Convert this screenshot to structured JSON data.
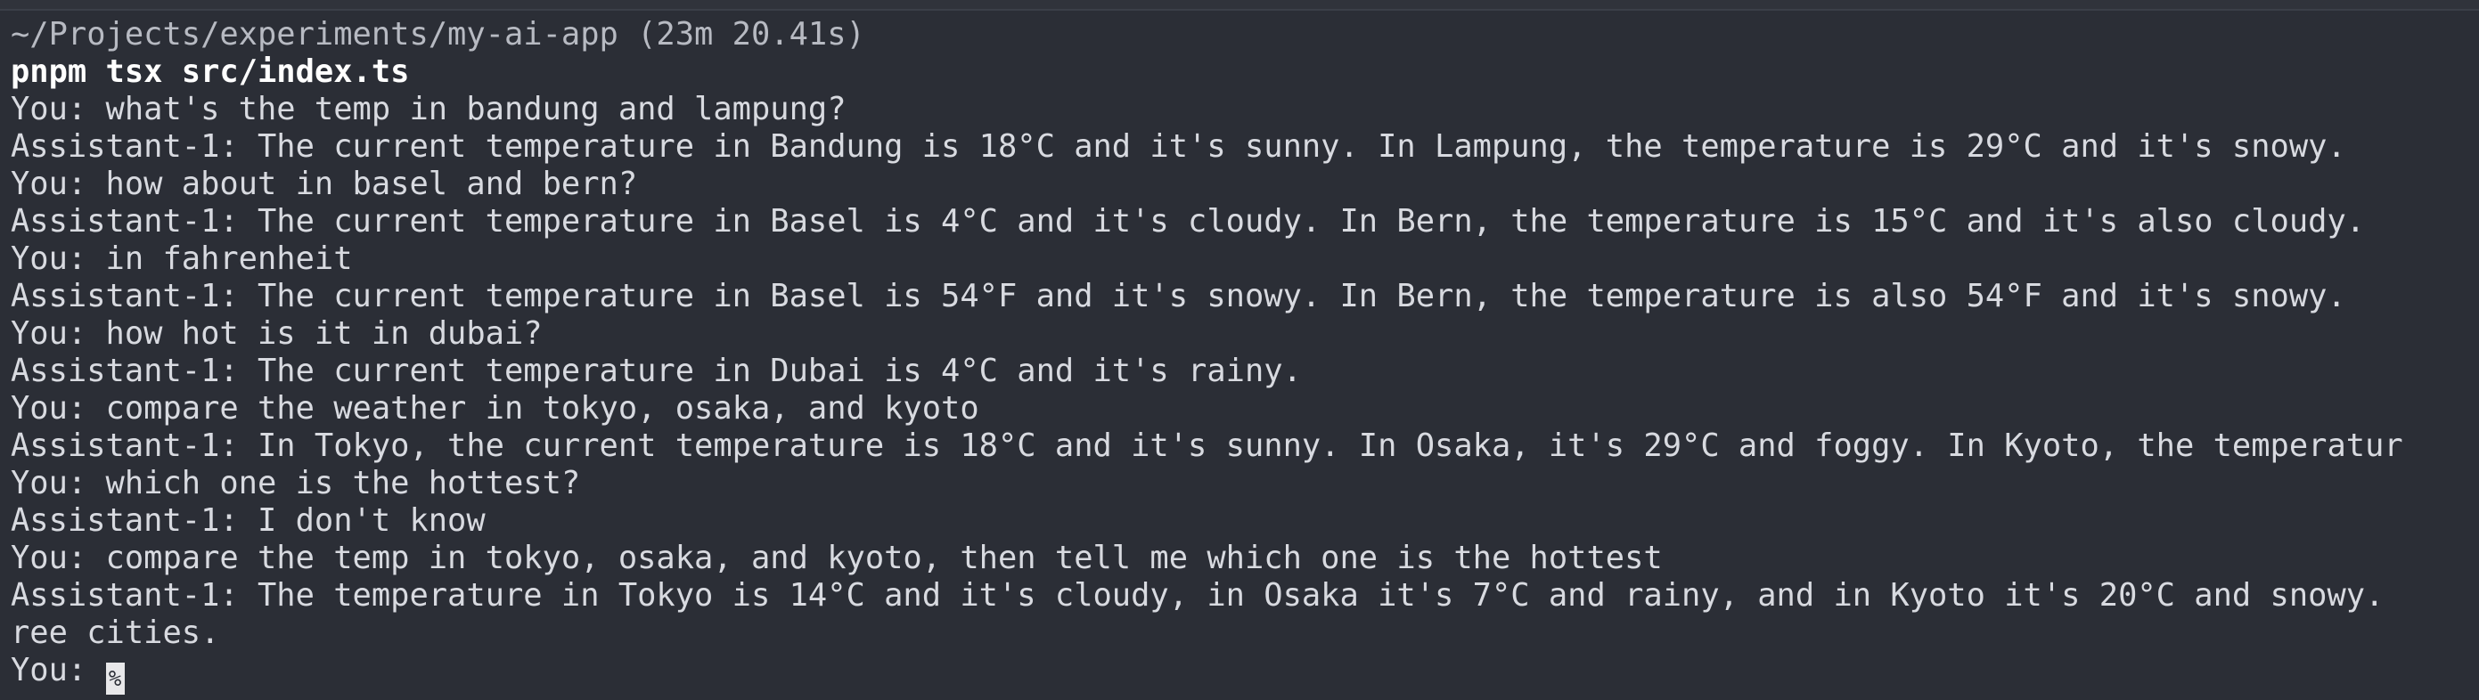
{
  "terminal": {
    "path_line": "~/Projects/experiments/my-ai-app (23m 20.41s)",
    "command": "pnpm tsx src/index.ts",
    "lines": [
      "You: what's the temp in bandung and lampung?",
      "Assistant-1: The current temperature in Bandung is 18°C and it's sunny. In Lampung, the temperature is 29°C and it's snowy.",
      "You: how about in basel and bern?",
      "Assistant-1: The current temperature in Basel is 4°C and it's cloudy. In Bern, the temperature is 15°C and it's also cloudy.",
      "You: in fahrenheit",
      "Assistant-1: The current temperature in Basel is 54°F and it's snowy. In Bern, the temperature is also 54°F and it's snowy.",
      "You: how hot is it in dubai?",
      "Assistant-1: The current temperature in Dubai is 4°C and it's rainy.",
      "You: compare the weather in tokyo, osaka, and kyoto",
      "Assistant-1: In Tokyo, the current temperature is 18°C and it's sunny. In Osaka, it's 29°C and foggy. In Kyoto, the temperatur",
      "You: which one is the hottest?",
      "Assistant-1: I don't know",
      "You: compare the temp in tokyo, osaka, and kyoto, then tell me which one is the hottest",
      "Assistant-1: The temperature in Tokyo is 14°C and it's cloudy, in Osaka it's 7°C and rainy, and in Kyoto it's 20°C and snowy.",
      "ree cities."
    ],
    "prompt": "You: ",
    "cursor_glyph": "%"
  }
}
